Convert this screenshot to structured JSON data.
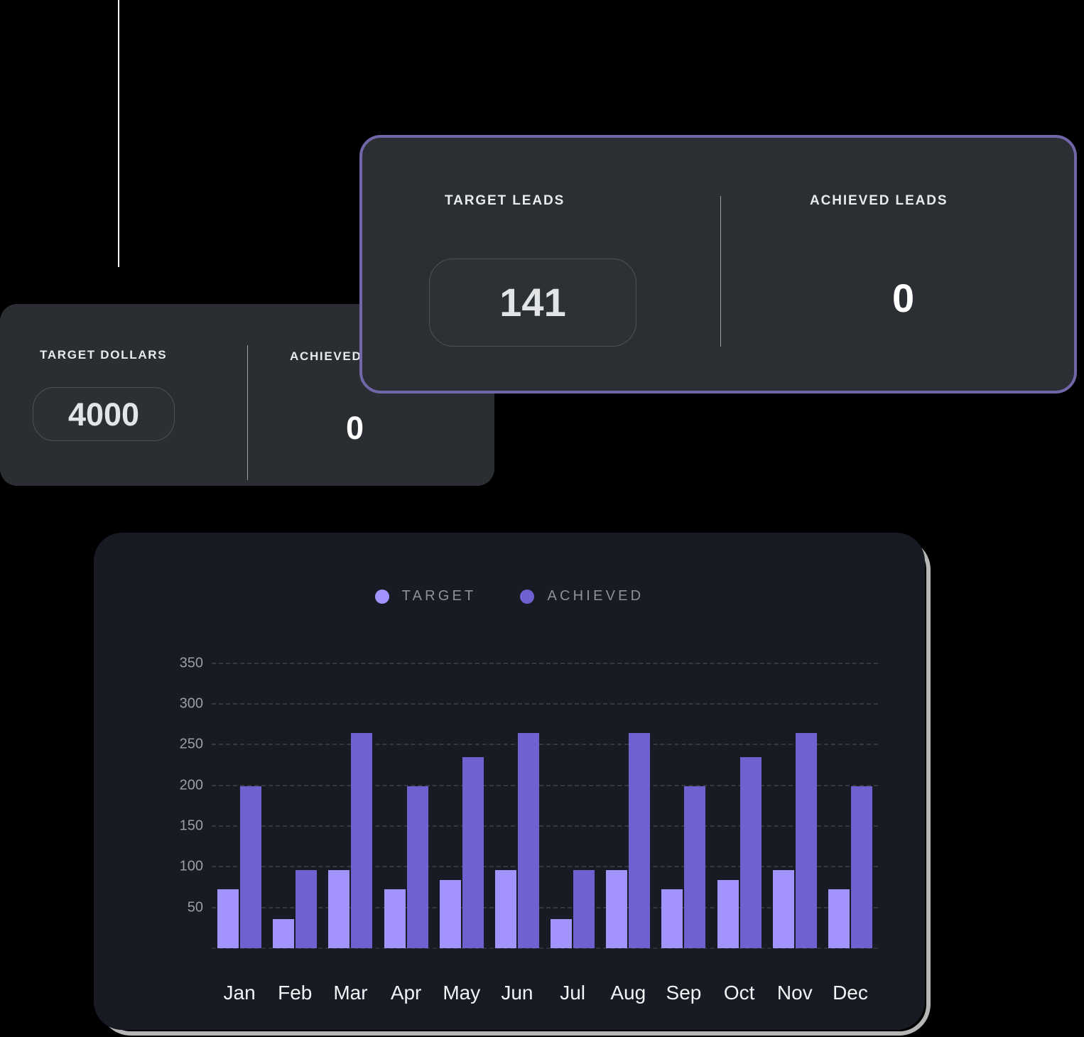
{
  "connector": {
    "name": "vertical-connector-line"
  },
  "dollars_card": {
    "target_label": "TARGET DOLLARS",
    "target_value": "4000",
    "achieved_label": "ACHIEVED",
    "achieved_value": "0"
  },
  "leads_card": {
    "target_label": "TARGET LEADS",
    "target_value": "141",
    "achieved_label": "ACHIEVED LEADS",
    "achieved_value": "0",
    "border_color": "#7066a8"
  },
  "chart_data": {
    "type": "bar",
    "title": "",
    "subtitle": "",
    "xlabel": "",
    "ylabel": "",
    "categories": [
      "Jan",
      "Feb",
      "Mar",
      "Apr",
      "May",
      "Jun",
      "Jul",
      "Aug",
      "Sep",
      "Oct",
      "Nov",
      "Dec"
    ],
    "series": [
      {
        "name": "TARGET",
        "color": "#a393fc",
        "values": [
          72,
          36,
          96,
          72,
          84,
          96,
          36,
          96,
          72,
          84,
          96,
          72
        ]
      },
      {
        "name": "ACHIEVED",
        "color": "#6f61cf",
        "values": [
          199,
          96,
          264,
          199,
          235,
          264,
          96,
          264,
          199,
          235,
          264,
          199
        ]
      }
    ],
    "yticks": [
      50,
      100,
      150,
      200,
      250,
      300,
      350
    ],
    "ylim": [
      0,
      375
    ],
    "grid": true,
    "grid_style": "dashed",
    "legend_position": "top-center"
  }
}
